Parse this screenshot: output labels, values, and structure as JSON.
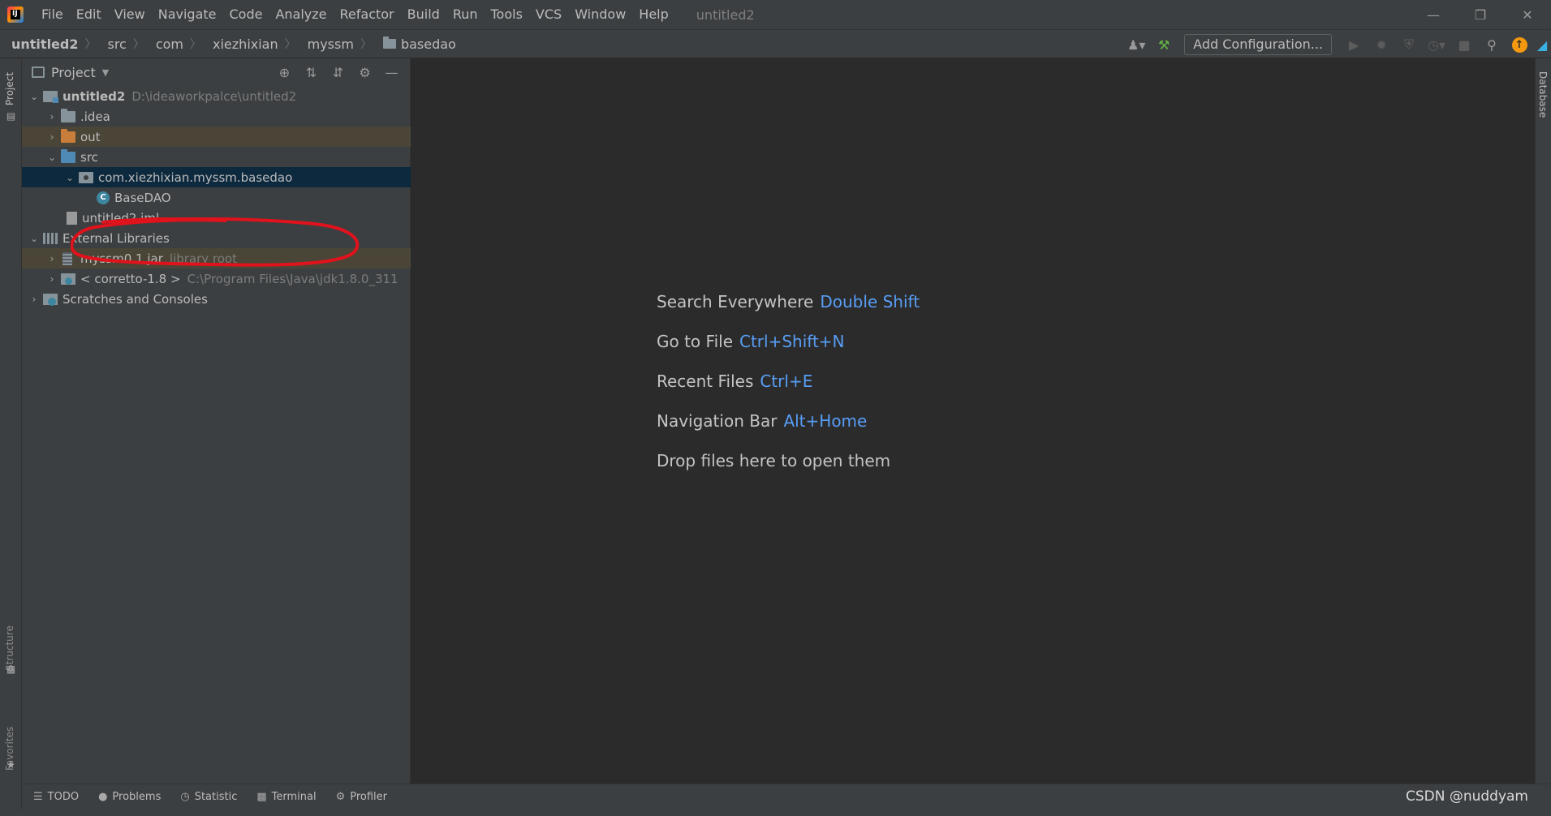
{
  "menubar": {
    "items": [
      "File",
      "Edit",
      "View",
      "Navigate",
      "Code",
      "Analyze",
      "Refactor",
      "Build",
      "Run",
      "Tools",
      "VCS",
      "Window",
      "Help"
    ],
    "window_title": "untitled2"
  },
  "navbar": {
    "breadcrumbs": [
      "untitled2",
      "src",
      "com",
      "xiezhixian",
      "myssm",
      "basedao"
    ],
    "add_configuration": "Add Configuration..."
  },
  "left_strip": {
    "project_label": "Project",
    "structure_label": "Structure",
    "favorites_label": "Favorites"
  },
  "project_panel": {
    "title": "Project",
    "tree": [
      {
        "name": "untitled2",
        "hint": "D:\\ideaworkpalce\\untitled2",
        "depth": 0,
        "expanded": true,
        "icon": "module-icon"
      },
      {
        "name": ".idea",
        "depth": 1,
        "expanded": false,
        "icon": "folder-icon"
      },
      {
        "name": "out",
        "depth": 1,
        "expanded": false,
        "icon": "folder-excluded-icon"
      },
      {
        "name": "src",
        "depth": 1,
        "expanded": true,
        "icon": "source-folder-icon"
      },
      {
        "name": "com.xiezhixian.myssm.basedao",
        "depth": 2,
        "expanded": true,
        "icon": "package-icon",
        "selected": true
      },
      {
        "name": "BaseDAO",
        "depth": 3,
        "icon": "class-icon"
      },
      {
        "name": "untitled2.iml",
        "depth": 1,
        "icon": "iml-file-icon"
      },
      {
        "name": "External Libraries",
        "depth": 0,
        "expanded": true,
        "icon": "libraries-icon"
      },
      {
        "name": "myssm0.1.jar",
        "hint": "library root",
        "depth": 1,
        "expanded": false,
        "icon": "jar-icon"
      },
      {
        "name": "< corretto-1.8 >",
        "hint": "C:\\Program Files\\Java\\jdk1.8.0_311",
        "depth": 1,
        "expanded": false,
        "icon": "jdk-icon"
      },
      {
        "name": "Scratches and Consoles",
        "depth": 0,
        "expanded": false,
        "icon": "scratches-icon"
      }
    ]
  },
  "editor": {
    "hints": [
      {
        "text": "Search Everywhere",
        "key": "Double Shift"
      },
      {
        "text": "Go to File",
        "key": "Ctrl+Shift+N"
      },
      {
        "text": "Recent Files",
        "key": "Ctrl+E"
      },
      {
        "text": "Navigation Bar",
        "key": "Alt+Home"
      },
      {
        "text": "Drop files here to open them",
        "key": ""
      }
    ]
  },
  "right_strip": {
    "database_label": "Database"
  },
  "bottom_bar": {
    "tabs": [
      {
        "label": "TODO",
        "icon": "list-icon"
      },
      {
        "label": "Problems",
        "icon": "info-icon"
      },
      {
        "label": "Statistic",
        "icon": "statistic-icon"
      },
      {
        "label": "Terminal",
        "icon": "terminal-icon"
      },
      {
        "label": "Profiler",
        "icon": "profiler-icon"
      }
    ]
  },
  "watermark": "CSDN @nuddyam",
  "colors": {
    "accent_key": "#589df6",
    "selection": "#0d293e",
    "ignored_row": "#4a4536",
    "annotation_red": "#e0121c"
  }
}
